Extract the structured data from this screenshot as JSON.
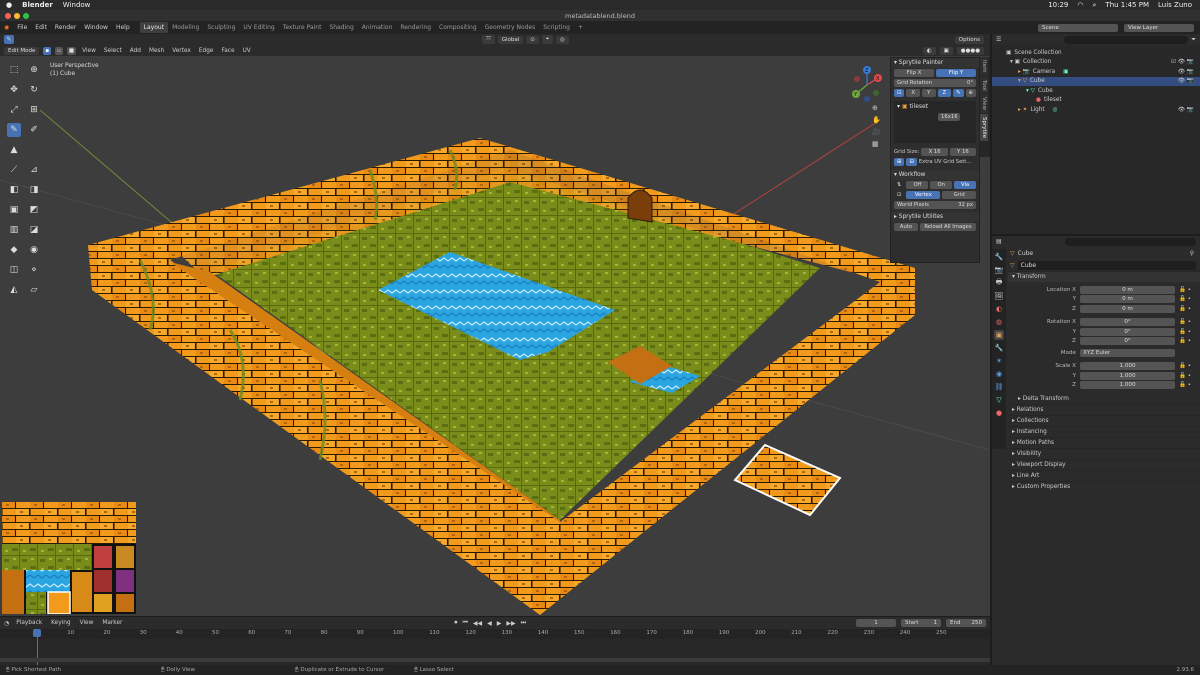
{
  "macos": {
    "apple": "",
    "app_name": "Blender",
    "menu": [
      "Window"
    ],
    "time": "Thu 1:45 PM",
    "user": "Luis Zuno",
    "clock_small": "10:29"
  },
  "window": {
    "title": "metadatablend.blend"
  },
  "blender_menu": [
    "File",
    "Edit",
    "Render",
    "Window",
    "Help"
  ],
  "workspaces": [
    "Layout",
    "Modeling",
    "Sculpting",
    "UV Editing",
    "Texture Paint",
    "Shading",
    "Animation",
    "Rendering",
    "Compositing",
    "Geometry Nodes",
    "Scripting"
  ],
  "active_workspace": "Layout",
  "scene": {
    "label": "Scene",
    "view_layer": "View Layer"
  },
  "viewport_header": {
    "mode": "Edit Mode",
    "menus": [
      "View",
      "Select",
      "Add",
      "Mesh",
      "Vertex",
      "Edge",
      "Face",
      "UV"
    ],
    "orientation": "Global",
    "options": "Options"
  },
  "viewport": {
    "perspective": "User Perspective",
    "object": "(1) Cube",
    "gizmo": {
      "x": "X",
      "y": "Y",
      "z": "Z"
    }
  },
  "sprytile": {
    "painter_title": "Sprytile Painter",
    "flip_x": "Flip X",
    "flip_y": "Flip Y",
    "grid_rotation": "Grid Rotation",
    "grid_rotation_value": "0°",
    "axes": [
      "X",
      "Y",
      "Z"
    ],
    "tileset_name": "tileset",
    "tileset_size": "16x16",
    "grid_size_label": "Grid Size:",
    "grid_x_label": "X",
    "grid_x": "16",
    "grid_y_label": "Y",
    "grid_y": "16",
    "extra_uv": "Extra UV Grid Sett...",
    "workflow_title": "Workflow",
    "workflow_off": "Off",
    "workflow_on": "On",
    "workflow_via": "Via",
    "vertex": "Vertex",
    "grid": "Grid",
    "world_pixels_label": "World Pixels",
    "world_pixels": "32 px",
    "utilities_title": "Sprytile Utilites",
    "auto": "Auto",
    "reload": "Reload All Images",
    "tabs": [
      "Item",
      "Tool",
      "View",
      "Sprytile"
    ]
  },
  "outliner": {
    "root": "Scene Collection",
    "items": [
      {
        "label": "Collection",
        "depth": 1
      },
      {
        "label": "Camera",
        "depth": 2
      },
      {
        "label": "Cube",
        "depth": 2
      },
      {
        "label": "Cube",
        "depth": 3
      },
      {
        "label": "tileset",
        "depth": 4
      },
      {
        "label": "Light",
        "depth": 2
      }
    ]
  },
  "properties": {
    "object_name": "Cube",
    "object_field": "Cube",
    "transform_title": "Transform",
    "location_label": "Location X",
    "location": [
      "0 m",
      "0 m",
      "0 m"
    ],
    "rotation_label": "Rotation X",
    "rotation": [
      "0°",
      "0°",
      "0°"
    ],
    "mode_label": "Mode",
    "mode": "XYZ Euler",
    "scale_label": "Scale X",
    "scale": [
      "1.000",
      "1.000",
      "1.000"
    ],
    "y_label": "Y",
    "z_label": "Z",
    "delta": "Delta Transform",
    "sections": [
      "Relations",
      "Collections",
      "Instancing",
      "Motion Paths",
      "Visibility",
      "Viewport Display",
      "Line Art",
      "Custom Properties"
    ]
  },
  "timeline": {
    "menus": [
      "Playback",
      "Keying",
      "View",
      "Marker"
    ],
    "current_frame": "1",
    "start_label": "Start",
    "start": "1",
    "end_label": "End",
    "end": "250",
    "ticks": [
      "1",
      "10",
      "20",
      "30",
      "40",
      "50",
      "60",
      "70",
      "80",
      "90",
      "100",
      "110",
      "120",
      "130",
      "140",
      "150",
      "160",
      "170",
      "180",
      "190",
      "200",
      "210",
      "220",
      "230",
      "240",
      "250"
    ]
  },
  "status": {
    "items": [
      "Pick Shortest Path",
      "Dolly View",
      "Duplicate or Extrude to Cursor",
      "Lasso Select"
    ],
    "version": "2.93.6"
  },
  "colors": {
    "accent": "#4772b3",
    "brick": "#f29a1c",
    "grass": "#7a8d1a",
    "water": "#2aa5e0"
  }
}
